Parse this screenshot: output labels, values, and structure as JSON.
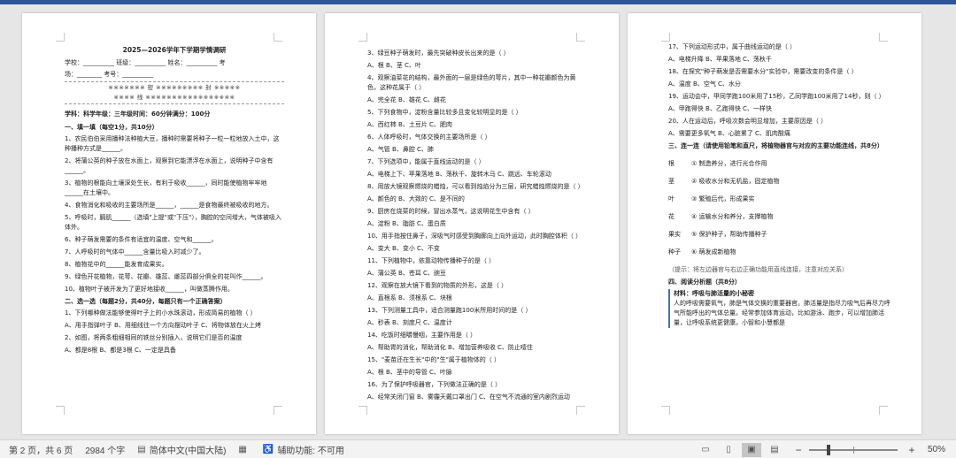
{
  "page1": {
    "title": "2025—2026学年下学期学情调研",
    "info_line1": "学校：__________ 班级：__________ 姓名：__________ 考",
    "info_line2": "场：________ 考号：__________",
    "seal_line1": "※※※※※※※ 密 ※※※※※※※※※ 封 ※※※※※",
    "seal_line2": "※※※※ 线 ※※※※※※※※※※※※※※※※※",
    "subtitle": "学科：科学年级：三年级时间：60分钟满分：100分",
    "sections": [
      {
        "heading": "一、填一填（每空1分，共10分）",
        "questions": [
          "1、农民伯伯采用播种法种植大豆，播种时需要将种子一粒一粒地放入土中，这种播种方式是______。",
          "2、将蒲公英的种子放在水面上，观察到它能漂浮在水面上，说明种子中含有______。",
          "3、植物的根能向土壤深处生长，有利于吸收______，同时能使植物牢牢地______在土壤中。",
          "4、食物消化和吸收的主要场所是______，______是食物最终被吸收的地方。",
          "5、呼吸时，膈肌______（选填\"上提\"或\"下压\"），胸腔的空间增大，气体被吸入体外。",
          "6、种子萌发需要的条件有适宜的温度、空气和______。",
          "7、人呼吸时的气体中______含量比吸入时减少了。",
          "8、植物花中的______能发育成果实。",
          "9、绿色开花植物，花萼、花瓣、雄蕊、雌蕊四部分俱全的花叫作______。",
          "10、植物叶子被开发为了更好地接收______，叫做蒸腾作用。"
        ]
      },
      {
        "heading": "二、选一选（每题2分，共40分，每题只有一个正确答案）",
        "questions": [
          "1、下列哪种做法能够使得叶子上的小水珠滚动，形成简易的植物（ ）",
          "A、用手指弹叶子   B、用细线往一个方向摆动叶子   C、将物体放在火上烤",
          "2、如图，将两条粗细相同的铁丝分别插入，说明它们是否的温度",
          "A、都是8根   B、都是3根   C、一定是具备"
        ]
      }
    ]
  },
  "page2": {
    "questions": [
      "3、绿豆种子萌发时，最先突破种皮长出来的是（ ）",
      "A、根   B、茎   C、叶",
      "4、观察油菜花的结构，最外面的一层是绿色的萼片，其中一种花瓣颜色为黄色，这种花属于（ ）",
      "A、完全花   B、雄花   C、雌花",
      "5、下列食物中，淀粉含量比较多且变化较明显的是（ ）",
      "A、西红柿   B、土豆片   C、肥肉",
      "6、人体呼吸时，气体交换的主要场所是（ ）",
      "A、气管   B、鼻腔   C、肺",
      "7、下列选项中，能属于直线运动的是（ ）",
      "A、电梯上下、苹果落地   B、荡秋千、旋转木马   C、跳远、车轮滚动",
      "8、用放大镜观察燃烧的蜡烛，可以看到烛焰分为三层，研究蜡烛燃烧的是（ ）",
      "A、颜色的   B、大致的   C、是不同的",
      "9、厨房在烧菜的时候，冒出水蒸气，这说明花生中含有（ ）",
      "A、淀粉   B、脂肪   C、蛋白质",
      "10、用手指按住鼻子，深吸气时感受到胸廓向上向外运动，此时胸腔体积（ ）",
      "A、变大   B、变小   C、不变",
      "11、下列植物中，依靠动物传播种子的是（ ）",
      "A、蒲公英   B、苍耳   C、豌豆",
      "12、观察在放大镜下看到的物质的外形，这是（ ）",
      "A、直根系   B、须根系   C、块根",
      "13、下列测量工具中，适合测量跑100米所用时间的是（ ）",
      "A、秒表   B、刻度尺   C、温度计",
      "14、吃饭时细嚼慢咽，主要作用是（ ）",
      "A、帮助胃的消化，帮助消化   B、增加营养吸收   C、防止噎住",
      "15、\"麦苗还在生长\"中的\"生\"属于植物体的（ ）",
      "A、根   B、茎中的导管   C、叶脉",
      "16、为了保护呼吸器官，下列做法正确的是（ ）",
      "A、经常关闭门窗   B、雾霾天戴口罩出门   C、在空气不流通的室内剧烈运动"
    ]
  },
  "page3": {
    "questions": [
      "17、下列运动形式中，属于曲线运动的是（ ）",
      "A、电梯升降   B、苹果落地   C、荡秋千",
      "18、在探究\"种子萌发是否需要水分\"实验中，需要改变的条件是（ ）",
      "A、温度   B、空气   C、水分",
      "19、运动会中，甲同学跑100米用了15秒，乙同学跑100米用了14秒，则（ ）",
      "A、甲跑得快   B、乙跑得快   C、一样快",
      "20、人在运动后，呼吸次数会明显增加，主要原因是（ ）",
      "A、需要更多氧气   B、心脏累了   C、肌肉酸痛"
    ],
    "section3_heading": "三、连一连（请使用铅笔和直尺，将植物器官与对应的主要功能连线，共8分）",
    "matches": [
      {
        "organ": "根",
        "func": "① 制造养分，进行光合作用"
      },
      {
        "organ": "茎",
        "func": "② 吸收水分和无机盐，固定植物"
      },
      {
        "organ": "叶",
        "func": "③ 繁殖后代，形成果实"
      },
      {
        "organ": "花",
        "func": "④ 运输水分和养分，支撑植物"
      },
      {
        "organ": "果实",
        "func": "⑤ 保护种子，帮助传播种子"
      },
      {
        "organ": "种子",
        "func": "⑥ 萌发成新植物"
      }
    ],
    "section3_note": "（提示：将左边器官与右边正确功能用直线连接，注意对应关系）",
    "section4_heading": "四、阅读分析题（共8分）",
    "material_title": "材料：呼吸与肺活量的小秘密",
    "material_text": "人的呼吸需要氧气，肺是气体交换的重要器官。肺活量是指尽力吸气后再尽力呼气所能呼出的气体总量。经常参加体育运动，比如游泳、跑步，可以增加肺活量，让呼吸系统更健康。小智和小慧都是"
  },
  "statusbar": {
    "page_info": "第 2 页，共 6 页",
    "word_count": "2984 个字",
    "language": "简体中文(中国大陆)",
    "accessibility": "辅助功能: 不可用",
    "zoom": "50%"
  }
}
